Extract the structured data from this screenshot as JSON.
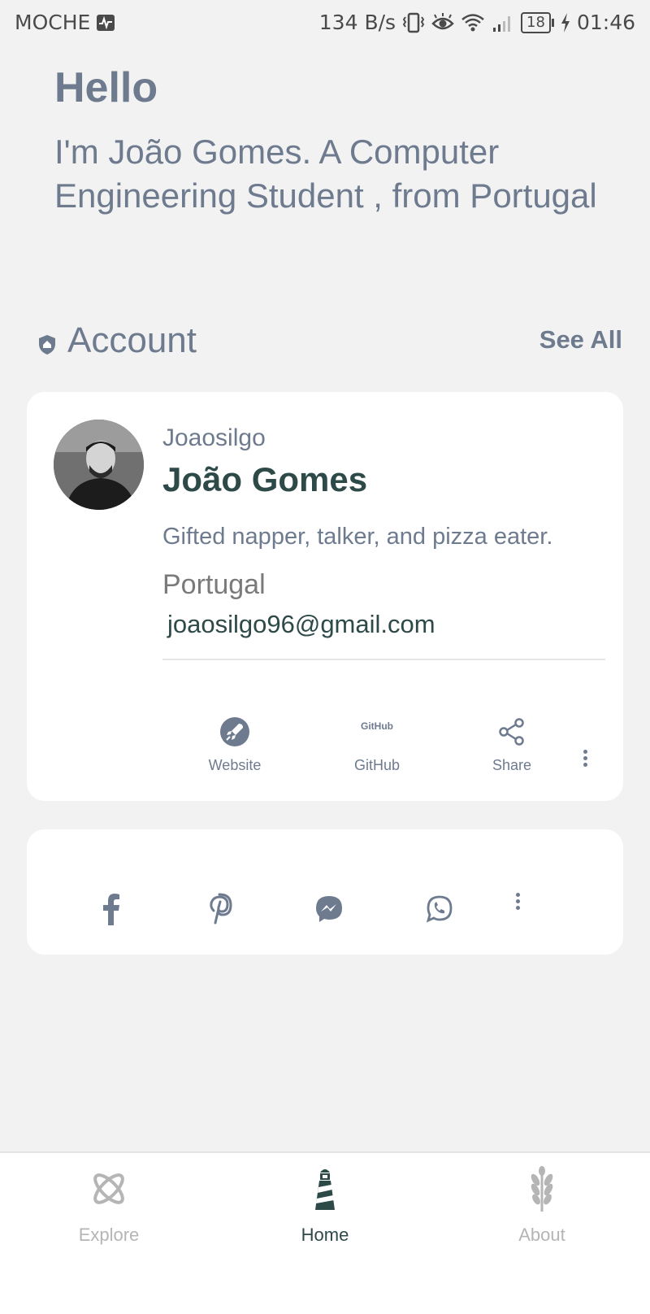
{
  "status_bar": {
    "carrier": "MOCHE",
    "net_speed": "134 B/s",
    "battery": "18",
    "time": "01:46"
  },
  "greeting": {
    "title": "Hello",
    "intro": "I'm João Gomes. A Computer Engineering Student , from Portugal"
  },
  "account_section": {
    "title": "Account",
    "see_all": "See All"
  },
  "profile": {
    "username": "Joaosilgo",
    "name": "João Gomes",
    "bio": "Gifted napper, talker, and pizza eater.",
    "location": "Portugal",
    "email": "joaosilgo96@gmail.com",
    "actions": [
      {
        "label": "Website",
        "icon": "rocket-icon"
      },
      {
        "label": "GitHub",
        "icon": "github-text-icon",
        "icon_text": "GitHub"
      },
      {
        "label": "Share",
        "icon": "share-icon"
      }
    ]
  },
  "social": {
    "icons": [
      "facebook-icon",
      "pinterest-icon",
      "messenger-icon",
      "whatsapp-icon"
    ]
  },
  "bottom_nav": {
    "items": [
      {
        "label": "Explore",
        "icon": "atom-icon",
        "active": false
      },
      {
        "label": "Home",
        "icon": "lighthouse-icon",
        "active": true
      },
      {
        "label": "About",
        "icon": "wheat-icon",
        "active": false
      }
    ]
  },
  "colors": {
    "heading": "#6e7b8f",
    "accent": "#2e4a48",
    "background": "#f2f2f2",
    "card": "#ffffff",
    "inactive_nav": "#b5b5b5"
  }
}
